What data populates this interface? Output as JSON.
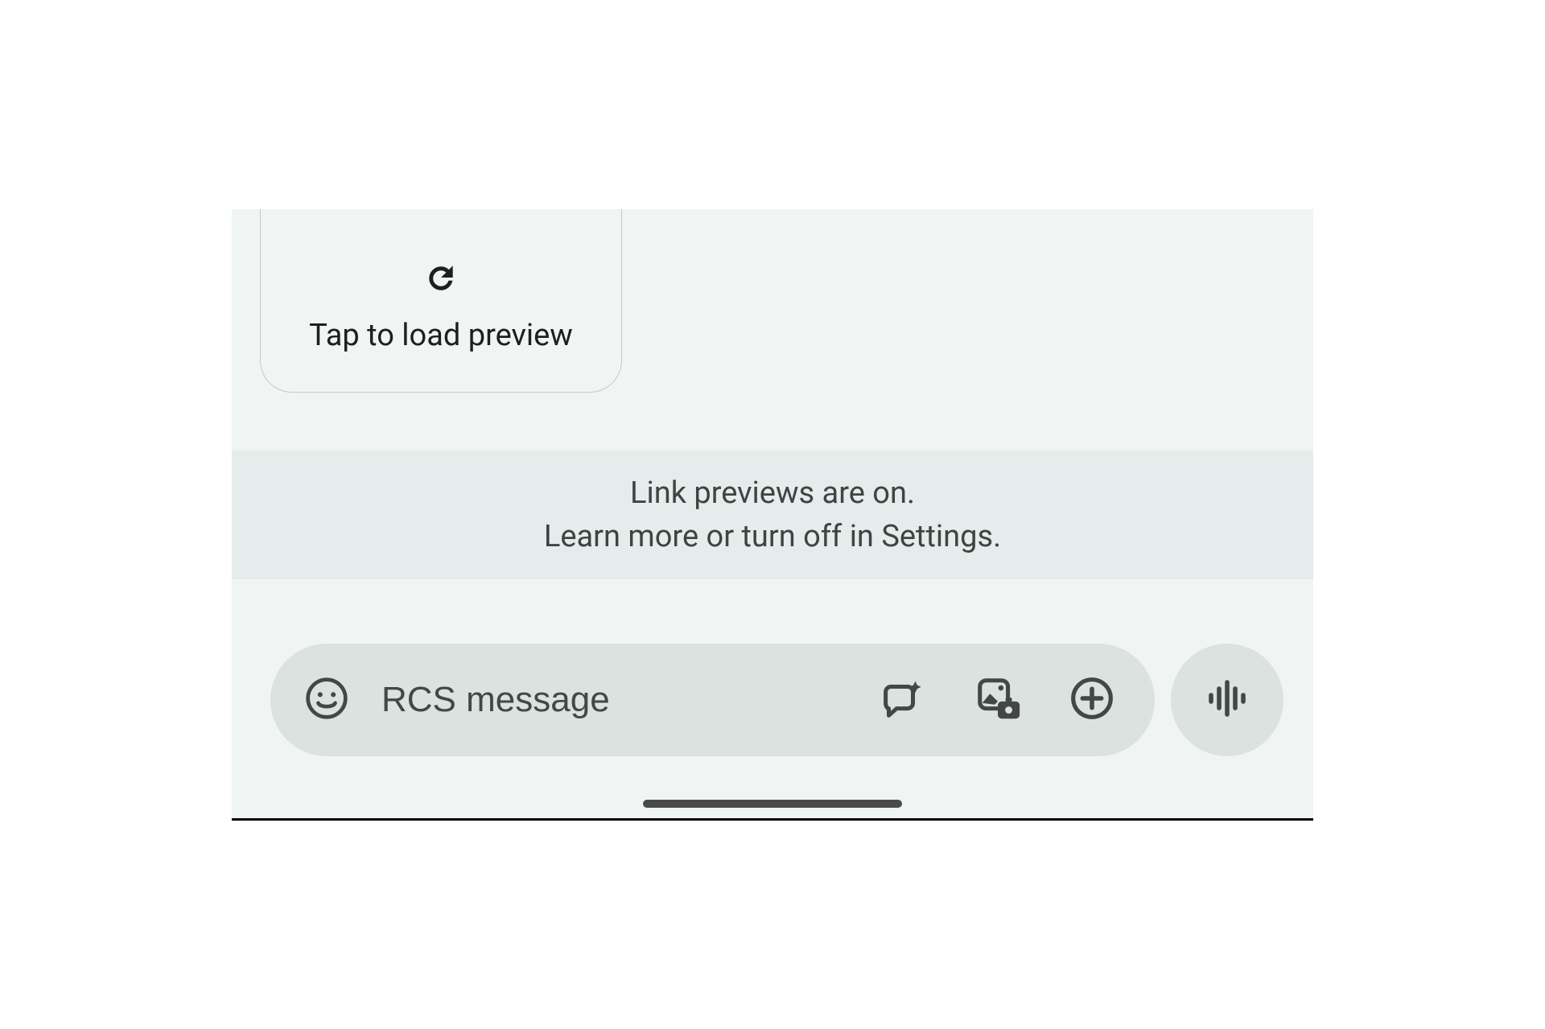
{
  "preview_card": {
    "label": "Tap to load preview",
    "icon": "refresh-icon"
  },
  "banner": {
    "line1": "Link previews are on.",
    "line2": "Learn more or turn off in Settings."
  },
  "compose": {
    "placeholder": "RCS message",
    "emoji_icon": "emoji-face-icon",
    "magic_icon": "magic-speech-icon",
    "gallery_icon": "gallery-camera-icon",
    "plus_icon": "plus-circle-icon",
    "voice_icon": "voice-waveform-icon"
  }
}
